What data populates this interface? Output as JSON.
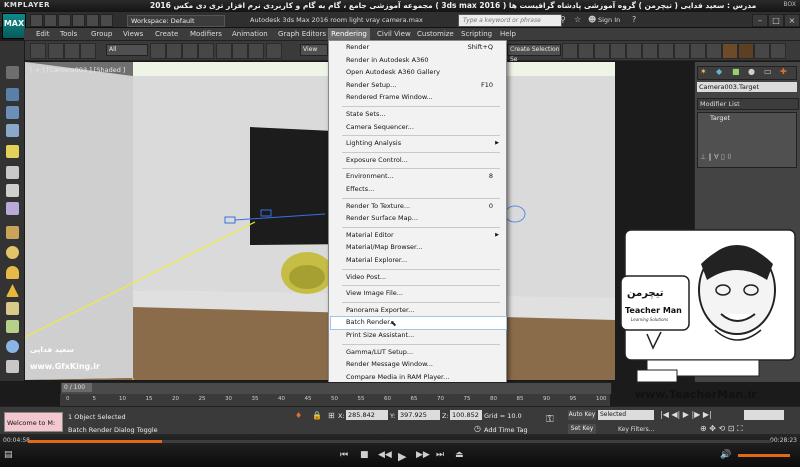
{
  "player": {
    "logo": "KMPLAYER",
    "title": "مجموعه آموزشی جامع ، گام به گام و کاربردی نرم افزار تری دی مکس 2016 ( 3ds max 2016 ) مدرس : سعید فدایی ( تیچرمن ) گروه آموزشی پادشاه گرافیست ها",
    "badge": "BOX",
    "time_current": "00:04:58",
    "time_total": "00:28:23",
    "progress_fraction": 0.18
  },
  "max": {
    "logo": "MAX",
    "workspace": "Workspace: Default",
    "app_title": "Autodesk 3ds Max 2016     room light vray camera.max",
    "search_placeholder": "Type a keyword or phrase",
    "signin": "Sign In",
    "menus": [
      "Edit",
      "Tools",
      "Group",
      "Views",
      "Create",
      "Modifiers",
      "Animation",
      "Graph Editors",
      "Rendering",
      "Civil View",
      "Customize",
      "Scripting",
      "Help"
    ],
    "active_menu": "Rendering",
    "filter_all": "All",
    "view_dd": "View",
    "selection_set": "Create Selection Se",
    "viewport_label": "[ + ] [Camera003 ] [Shaded ]"
  },
  "rendering_menu": [
    {
      "label": "Render",
      "shortcut": "Shift+Q"
    },
    {
      "label": "Render in Autodesk A360"
    },
    {
      "label": "Open Autodesk A360 Gallery"
    },
    {
      "label": "Render Setup...",
      "shortcut": "F10"
    },
    {
      "label": "Rendered Frame Window..."
    },
    {
      "sep": true
    },
    {
      "label": "State Sets..."
    },
    {
      "label": "Camera Sequencer..."
    },
    {
      "sep": true
    },
    {
      "label": "Lighting Analysis",
      "submenu": true
    },
    {
      "sep": true
    },
    {
      "label": "Exposure Control..."
    },
    {
      "sep": true
    },
    {
      "label": "Environment...",
      "shortcut": "8"
    },
    {
      "label": "Effects..."
    },
    {
      "sep": true
    },
    {
      "label": "Render To Texture...",
      "shortcut": "0"
    },
    {
      "label": "Render Surface Map..."
    },
    {
      "sep": true
    },
    {
      "label": "Material Editor",
      "submenu": true
    },
    {
      "label": "Material/Map Browser..."
    },
    {
      "label": "Material Explorer..."
    },
    {
      "sep": true
    },
    {
      "label": "Video Post..."
    },
    {
      "sep": true
    },
    {
      "label": "View Image File..."
    },
    {
      "sep": true
    },
    {
      "label": "Panorama Exporter..."
    },
    {
      "label": "Batch Render...",
      "highlighted": true
    },
    {
      "label": "Print Size Assistant..."
    },
    {
      "sep": true
    },
    {
      "label": "Gamma/LUT Setup..."
    },
    {
      "label": "Render Message Window..."
    },
    {
      "label": "Compare Media in RAM Player..."
    }
  ],
  "command_panel": {
    "object_name": "Camera003.Target",
    "modifier_list": "Modifier List",
    "stack_item": "Target"
  },
  "timeline": {
    "frame_label": "0 / 100",
    "ticks": [
      "0",
      "5",
      "10",
      "15",
      "20",
      "25",
      "30",
      "35",
      "40",
      "45",
      "50",
      "55",
      "60",
      "65",
      "70",
      "75",
      "80",
      "85",
      "90",
      "95",
      "100"
    ]
  },
  "status": {
    "script_box": "Welcome to M:",
    "selected_msg": "1 Object Selected",
    "prompt_msg": "Batch Render Dialog Toggle",
    "x_label": "X:",
    "x_val": "285.842",
    "y_label": "Y:",
    "y_val": "397.925",
    "z_label": "Z:",
    "z_val": "100.852",
    "grid": "Grid = 10.0",
    "add_time_tag": "Add Time Tag",
    "auto_key": "Auto Key",
    "set_key": "Set Key",
    "selected_dd": "Selected",
    "key_filters": "Key Filters..."
  },
  "watermark": {
    "author_fa": "سعید فدایی",
    "gfx_site": "www.GfxKing.ir",
    "teacher_site": "www.TeacherMan.ir",
    "badge_en": "Teacher Man",
    "badge_fa": "تیچرمن",
    "badge_sub": "Learning Solutions"
  },
  "colors": {
    "accent_orange": "#e06a1a",
    "menu_bg": "#f2f2f2",
    "ui_dark": "#3a3a3a",
    "wall": "#d9d9d9",
    "floor": "#8a6c4a",
    "ceiling_light": "#e6f0dc",
    "chair_yellow": "#c9c04a",
    "selection_yellow": "#f0ea3c"
  }
}
